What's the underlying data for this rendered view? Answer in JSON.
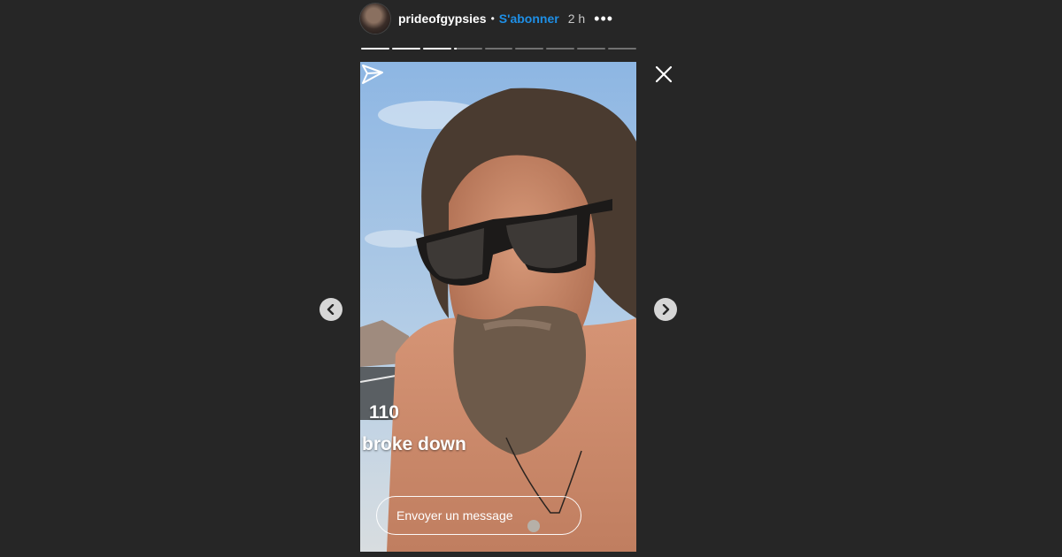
{
  "header": {
    "username": "prideofgypsies",
    "separator": "•",
    "follow_label": "S'abonner",
    "time": "2 h",
    "more_label": "•••"
  },
  "progress": {
    "segments": 9,
    "completed": 3,
    "current_fraction": 0.1
  },
  "story": {
    "overlay_number": "110",
    "overlay_text": "broke down"
  },
  "reply": {
    "placeholder": "Envoyer un message"
  },
  "icons": {
    "close": "close-icon",
    "send": "send-icon",
    "prev": "chevron-left-icon",
    "next": "chevron-right-icon"
  },
  "colors": {
    "background": "#262626",
    "accent": "#1e8fe6"
  }
}
